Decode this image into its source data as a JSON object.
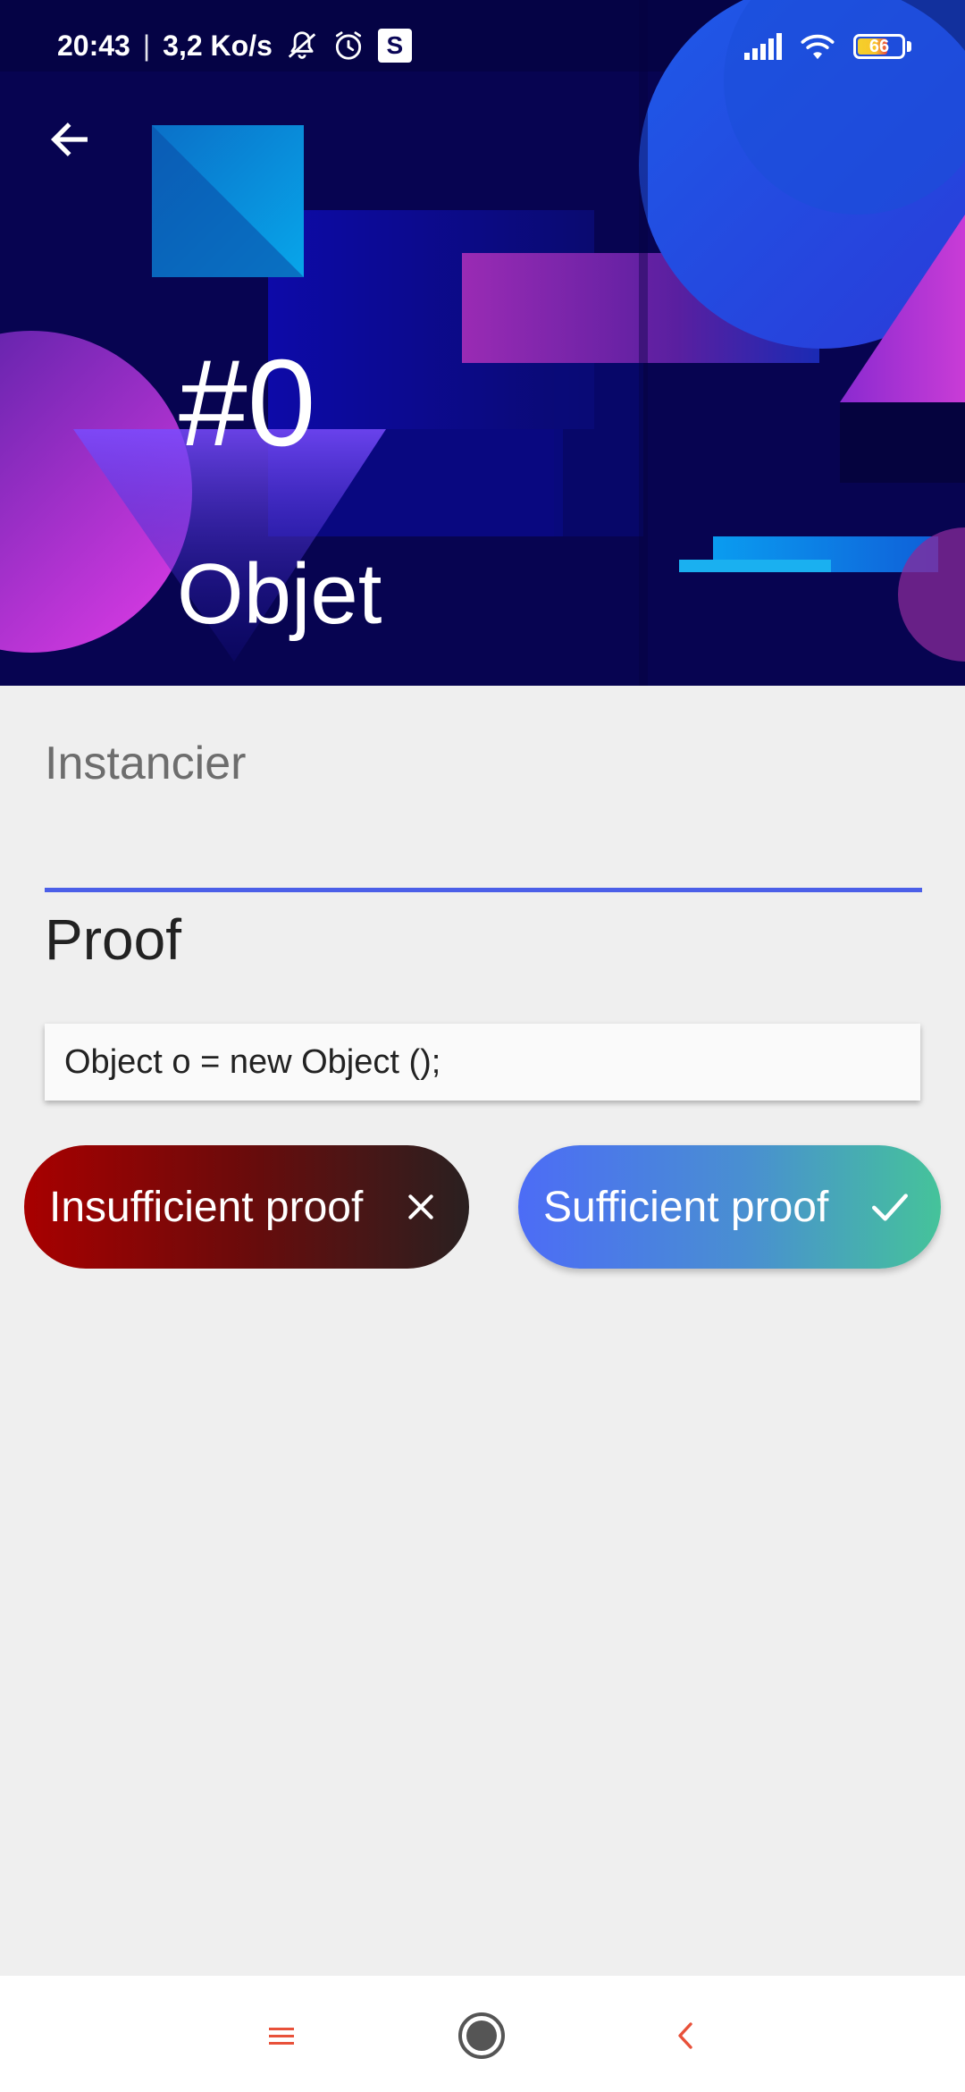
{
  "status_bar": {
    "time": "20:43",
    "separator": "|",
    "network_speed": "3,2 Ko/s",
    "battery_level": "66",
    "icons": [
      "muted-bell-icon",
      "alarm-icon",
      "s-app-icon",
      "signal-icon",
      "wifi-icon",
      "battery-icon"
    ],
    "s_badge_label": "S"
  },
  "header": {
    "number": "#0",
    "title": "Objet",
    "back_icon": "arrow-left-icon"
  },
  "field": {
    "label": "Instancier",
    "underline_color": "#4b5fe8"
  },
  "proof": {
    "title": "Proof",
    "code": "Object o = new Object ();"
  },
  "actions": {
    "insufficient_label": "Insufficient proof",
    "insufficient_icon": "close-icon",
    "sufficient_label": "Sufficient proof",
    "sufficient_icon": "check-icon"
  },
  "nav": {
    "icons": [
      "menu-icon",
      "home-icon",
      "back-chevron-icon"
    ],
    "accent": "#e8513a"
  },
  "colors": {
    "header_bg": "#0a0656",
    "page_bg": "#efefef",
    "insufficient_gradient": [
      "#a80000",
      "#2a2020"
    ],
    "sufficient_gradient": [
      "#4c6cf6",
      "#45c39a"
    ]
  }
}
